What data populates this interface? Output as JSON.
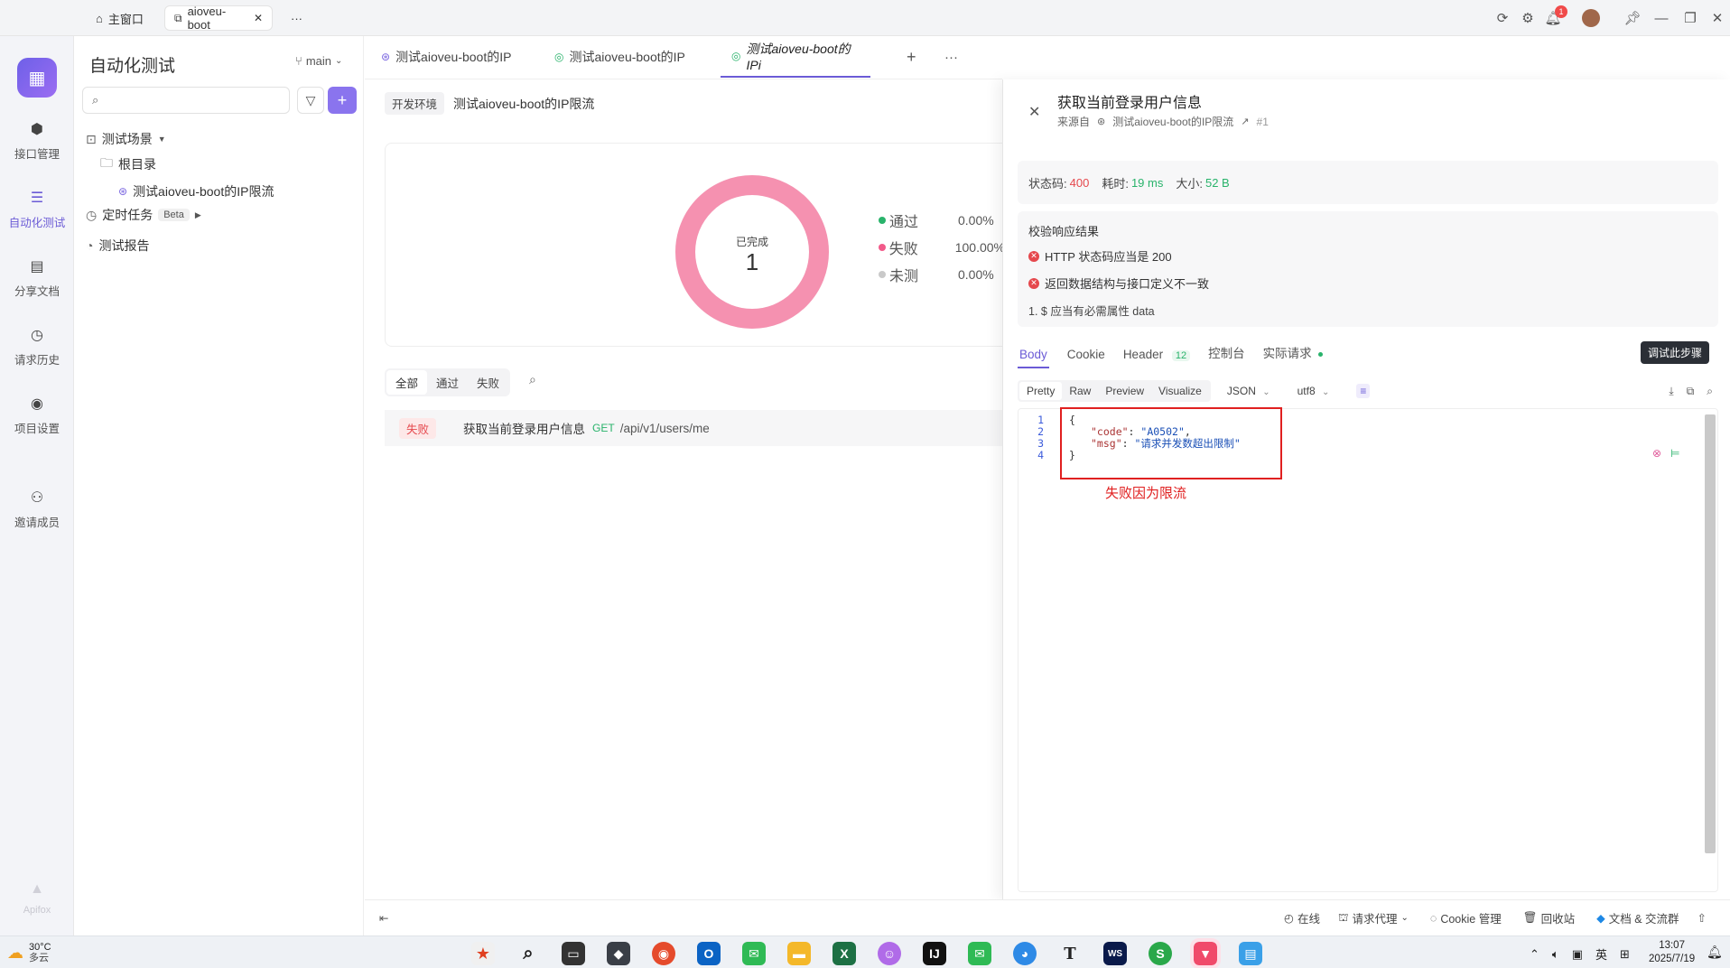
{
  "titlebar": {
    "home_tab": "主窗口",
    "project_tab": "aioveu-boot",
    "more": "···",
    "notification_count": "1"
  },
  "rail": {
    "items": [
      {
        "label": "接口管理"
      },
      {
        "label": "自动化测试"
      },
      {
        "label": "分享文档"
      },
      {
        "label": "请求历史"
      },
      {
        "label": "项目设置"
      },
      {
        "label": "邀请成员"
      }
    ],
    "brand": "Apifox"
  },
  "sidebar": {
    "title": "自动化测试",
    "branch": "main",
    "search_placeholder": "",
    "tree": {
      "scenes": "测试场景",
      "root": "根目录",
      "case": "测试aioveu-boot的IP限流",
      "scheduled": "定时任务",
      "beta": "Beta",
      "report": "测试报告"
    }
  },
  "main": {
    "tabs": [
      {
        "label": "测试aioveu-boot的IP"
      },
      {
        "label": "测试aioveu-boot的IP"
      },
      {
        "label": "测试aioveu-boot的IPi"
      }
    ],
    "env_label": "开发环境",
    "scene_name": "测试aioveu-boot的IP限流",
    "donut": {
      "center_label": "已完成",
      "center_value": "1",
      "fail_fraction": 1.0
    },
    "legend": [
      {
        "label": "通过",
        "value": "0.00%",
        "color": "#29b36b"
      },
      {
        "label": "失败",
        "value": "100.00%",
        "color": "#f25a8a"
      },
      {
        "label": "未测",
        "value": "0.00%",
        "color": "#c9c9c9"
      }
    ],
    "filters": [
      "全部",
      "通过",
      "失败"
    ],
    "result_row": {
      "status": "失败",
      "name": "获取当前登录用户信息",
      "method": "GET",
      "path": "/api/v1/users/me"
    }
  },
  "drawer": {
    "title": "获取当前登录用户信息",
    "source_label": "来源自",
    "source_name": "测试aioveu-boot的IP限流",
    "source_index": "#1",
    "status_label": "状态码:",
    "status_value": "400",
    "time_label": "耗时:",
    "time_value": "19 ms",
    "size_label": "大小:",
    "size_value": "52 B",
    "assert_title": "校验响应结果",
    "assertions": [
      "HTTP 状态码应当是 200",
      "返回数据结构与接口定义不一致"
    ],
    "assert_detail": "1. $ 应当有必需属性 data",
    "resp_tabs": [
      {
        "label": "Body"
      },
      {
        "label": "Cookie"
      },
      {
        "label": "Header",
        "count": "12"
      },
      {
        "label": "控制台"
      },
      {
        "label": "实际请求"
      }
    ],
    "debug_button": "调试此步骤",
    "format_tabs": [
      "Pretty",
      "Raw",
      "Preview",
      "Visualize"
    ],
    "format": "JSON",
    "encoding": "utf8",
    "line_numbers": [
      "1",
      "2",
      "3",
      "4"
    ],
    "code": {
      "open": "{",
      "k1": "\"code\"",
      "v1": "\"A0502\"",
      "k2": "\"msg\"",
      "v2": "\"请求并发数超出限制\"",
      "close": "}"
    },
    "annotation": "失败因为限流"
  },
  "bottombar": {
    "online": "在线",
    "proxy": "请求代理",
    "cookie": "Cookie 管理",
    "recycle": "回收站",
    "docs": "文档 & 交流群"
  },
  "taskbar": {
    "weather_temp": "30°C",
    "weather_desc": "多云",
    "lang": "英",
    "time": "13:07",
    "date": "2025/7/19"
  },
  "colors": {
    "accent": "#6b5bd6",
    "fail": "#f25a8a",
    "pass": "#29b36b",
    "status_error": "#e5484d",
    "annotation_red": "#e02020"
  }
}
